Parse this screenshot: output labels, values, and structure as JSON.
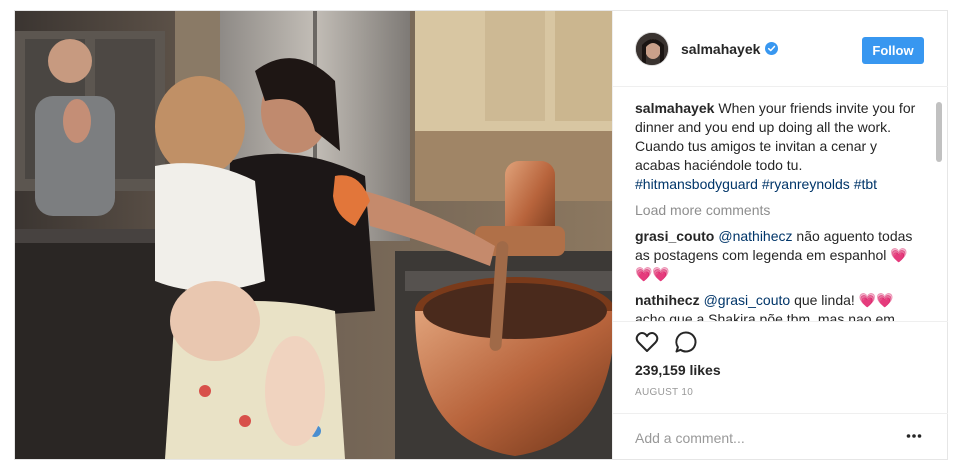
{
  "post": {
    "username": "salmahayek",
    "follow_label": "Follow",
    "verified_icon": "verified-badge-icon",
    "caption": {
      "user": "salmahayek",
      "text": "When your friends invite you for dinner and you end up doing all the work. Cuando tus amigos te invitan a cenar y acabas haciéndole todo tu.",
      "hashtags": "#hitmansbodyguard #ryanreynolds #tbt"
    },
    "load_more": "Load more comments",
    "comments": [
      {
        "user": "grasi_couto",
        "mention": "@nathihecz",
        "text": "não aguento todas as postagens com legenda em espanhol",
        "emoji": "💗💗💗"
      },
      {
        "user": "nathihecz",
        "mention": "@grasi_couto",
        "text": "que linda!",
        "emoji": "💗💗",
        "text2": "acho que a Shakira põe tbm, mas nao em"
      }
    ],
    "likes": "239,159 likes",
    "date": "AUGUST 10",
    "add_comment_placeholder": "Add a comment...",
    "icons": [
      "heart-icon",
      "speech-bubble-icon",
      "ellipsis-icon"
    ]
  },
  "colors": {
    "follow_button": "#3897f0",
    "link": "#003569",
    "muted": "#8e8e8e"
  }
}
